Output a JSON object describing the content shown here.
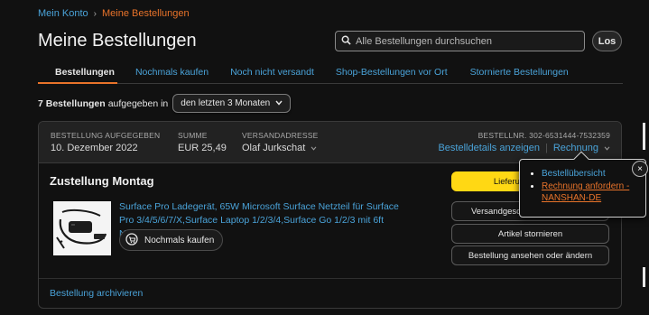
{
  "breadcrumb": {
    "parent": "Mein Konto",
    "separator": "›",
    "current": "Meine Bestellungen"
  },
  "page_title": "Meine Bestellungen",
  "search": {
    "placeholder": "Alle Bestellungen durchsuchen",
    "button_label": "Los"
  },
  "tabs": [
    {
      "label": "Bestellungen",
      "active": true
    },
    {
      "label": "Nochmals kaufen",
      "active": false
    },
    {
      "label": "Noch nicht versandt",
      "active": false
    },
    {
      "label": "Shop-Bestellungen vor Ort",
      "active": false
    },
    {
      "label": "Stornierte Bestellungen",
      "active": false
    }
  ],
  "filter": {
    "count_text": "7 Bestellungen",
    "suffix": "aufgegeben in",
    "range_selected": "den letzten 3 Monaten"
  },
  "order": {
    "placed_label": "BESTELLUNG AUFGEGEBEN",
    "placed_value": "10. Dezember 2022",
    "total_label": "SUMME",
    "total_value": "EUR 25,49",
    "ship_label": "VERSANDADRESSE",
    "ship_value": "Olaf Jurkschat",
    "order_number_label": "BESTELLNR. 302-6531444-7532359",
    "details_link": "Bestelldetails anzeigen",
    "invoice_link": "Rechnung",
    "delivery_title": "Zustellung Montag",
    "product_title": "Surface Pro Ladegerät, 65W Microsoft Surface Netzteil für Surface Pro 3/4/5/6/7/X,Surface Laptop 1/2/3/4,Surface Go 1/2/3 mit 6ft Netzkabel",
    "buy_again_label": "Nochmals kaufen",
    "actions": {
      "track": "Lieferung verfolgen",
      "problem": "Versandgeschwindigkeit ändern",
      "cancel": "Artikel stornieren",
      "view_edit": "Bestellung ansehen oder ändern"
    },
    "archive_link": "Bestellung archivieren"
  },
  "invoice_popover": {
    "items": [
      "Bestellübersicht",
      "Rechnung anfordern - NANSHAN-DE"
    ],
    "close_symbol": "×"
  },
  "colors": {
    "background": "#111111",
    "link": "#4aa3d9",
    "accent_orange": "#e8732a",
    "primary_button": "#ffd814"
  }
}
